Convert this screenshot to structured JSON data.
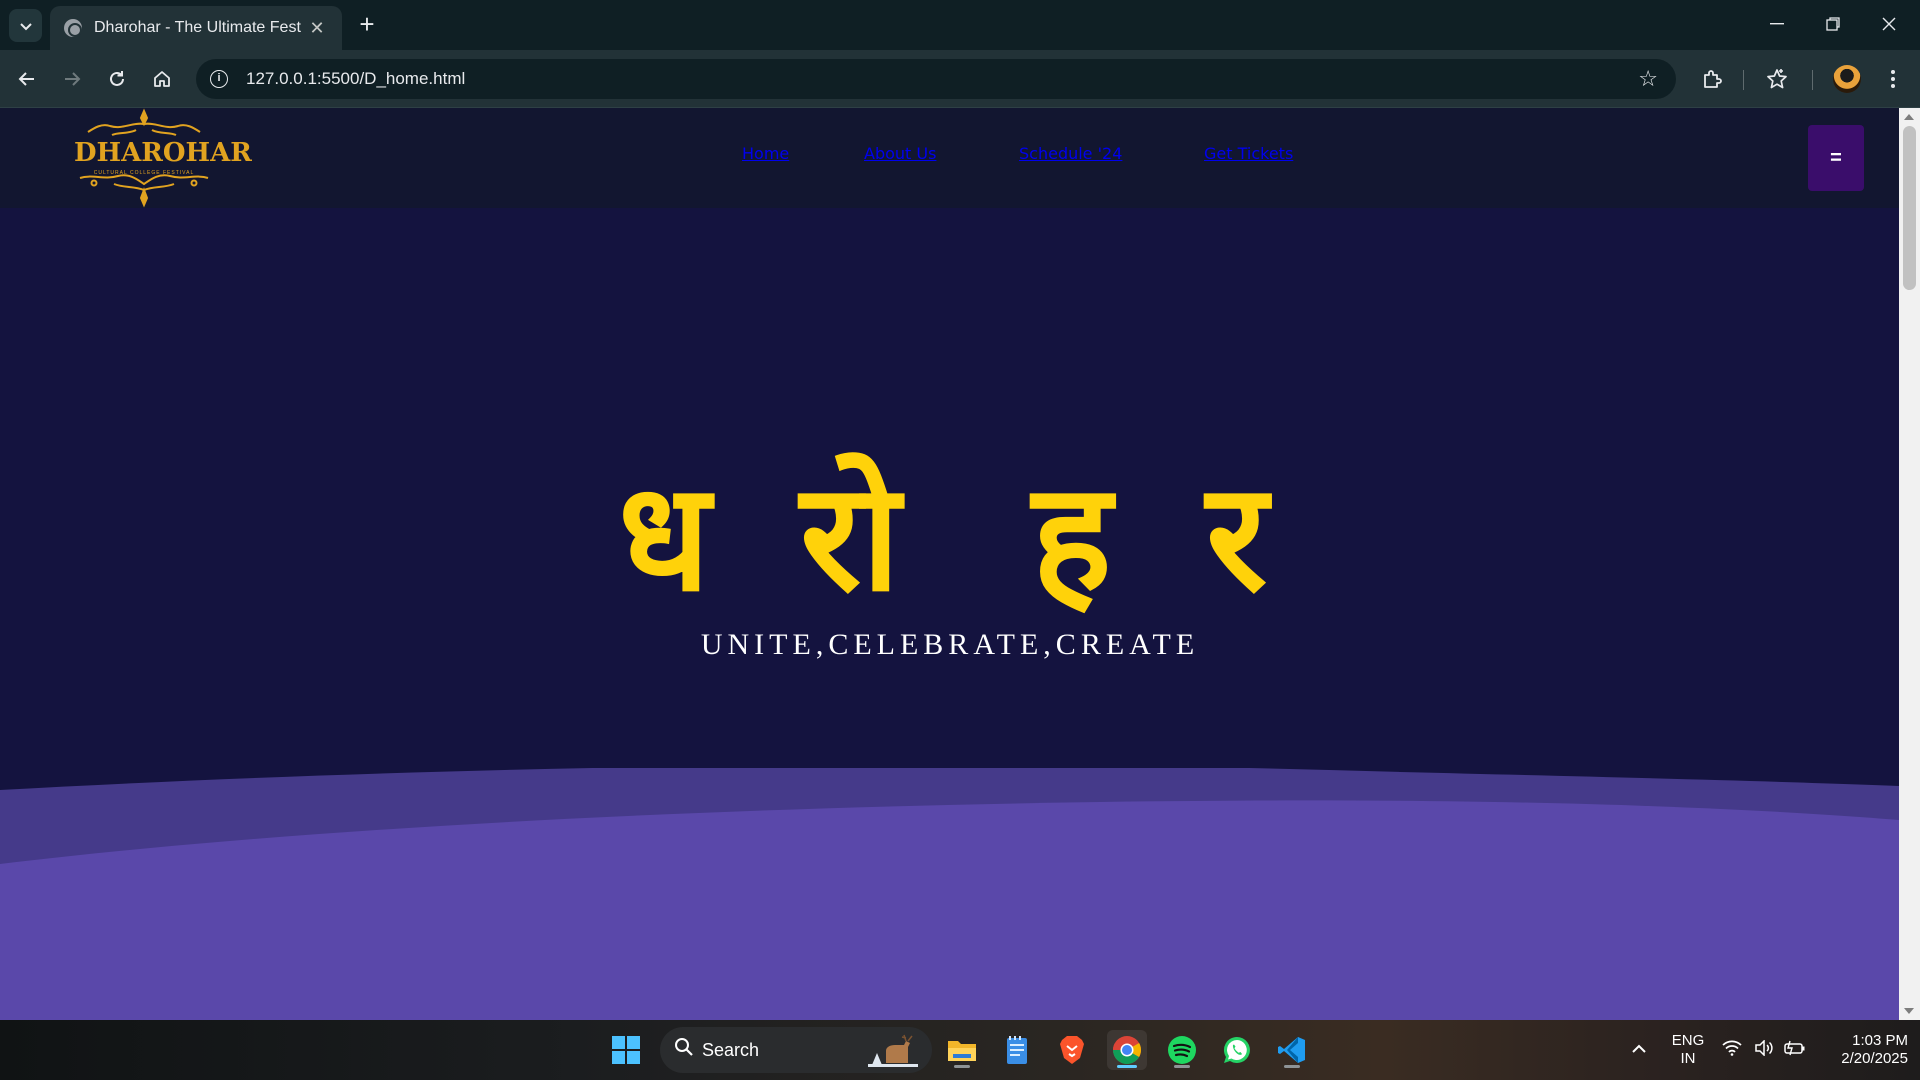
{
  "browser": {
    "tab_title": "Dharohar - The Ultimate Fest",
    "new_tab_label": "+",
    "url": "127.0.0.1:5500/D_home.html"
  },
  "site": {
    "logo_text": "DHAROHAR",
    "logo_subtext": "CULTURAL COLLEGE FESTIVAL",
    "nav": [
      "Home",
      "About Us",
      "Schedule '24",
      "Get Tickets"
    ],
    "menu_button_label": "=",
    "hero_title_chars": [
      "ध",
      "रो",
      "ह",
      "र"
    ],
    "tagline": "UNITE,CELEBRATE,CREATE",
    "colors": {
      "header_bg": "#121630",
      "hero_bg": "#14133f",
      "title_yellow": "#ffd20a",
      "logo_gold": "#e1a320",
      "menu_button_bg": "#3a0d6b",
      "wave_back": "#453a8a",
      "wave_front": "#5a48aa"
    }
  },
  "taskbar": {
    "search_label": "Search",
    "apps": [
      "windows-start",
      "file-explorer",
      "notepad",
      "brave",
      "chrome",
      "spotify",
      "whatsapp",
      "vscode"
    ],
    "language": "ENG",
    "region": "IN",
    "time": "1:03 PM",
    "date": "2/20/2025"
  }
}
